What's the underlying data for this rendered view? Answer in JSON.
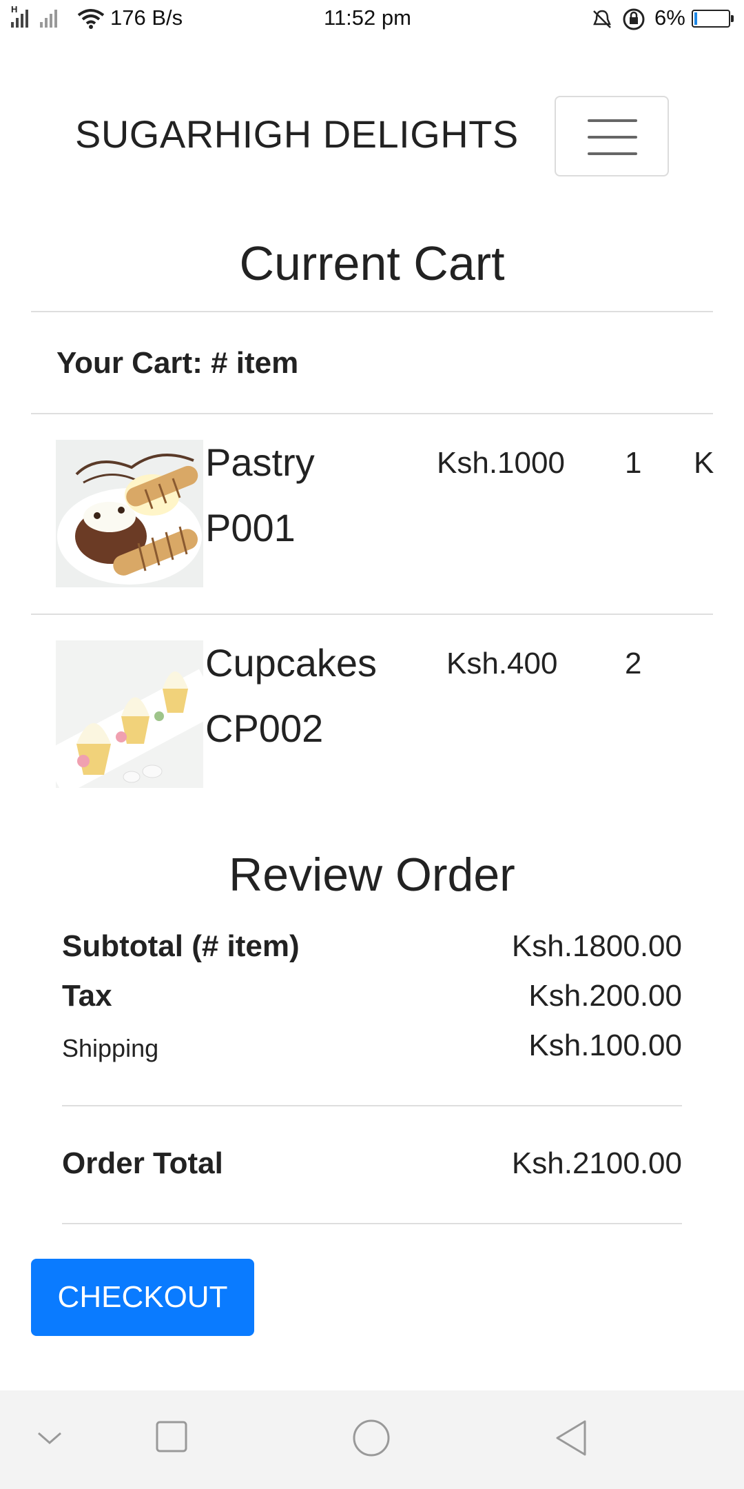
{
  "status_bar": {
    "signal_label": "H",
    "net_speed": "176 B/s",
    "time": "11:52 pm",
    "battery": "6%"
  },
  "navbar": {
    "brand": "SUGARHIGH DELIGHTS"
  },
  "cart": {
    "title": "Current Cart",
    "count_label": "Your Cart: # item",
    "items": [
      {
        "name": "Pastry",
        "code": "P001",
        "price": "Ksh.1000",
        "qty": "1",
        "total": "K"
      },
      {
        "name": "Cupcakes",
        "code": "CP002",
        "price": "Ksh.400",
        "qty": "2"
      }
    ]
  },
  "review": {
    "title": "Review Order",
    "subtotal_label": "Subtotal (# item)",
    "subtotal_value": "Ksh.1800.00",
    "tax_label": "Tax",
    "tax_value": "Ksh.200.00",
    "shipping_label": "Shipping",
    "shipping_value": "Ksh.100.00",
    "total_label": "Order Total",
    "total_value": "Ksh.2100.00"
  },
  "checkout_label": "CHECKOUT",
  "colors": {
    "primary": "#0a7bff",
    "text": "#212529",
    "divider": "#dedede",
    "nav_bar_bg": "#f3f3f3"
  }
}
